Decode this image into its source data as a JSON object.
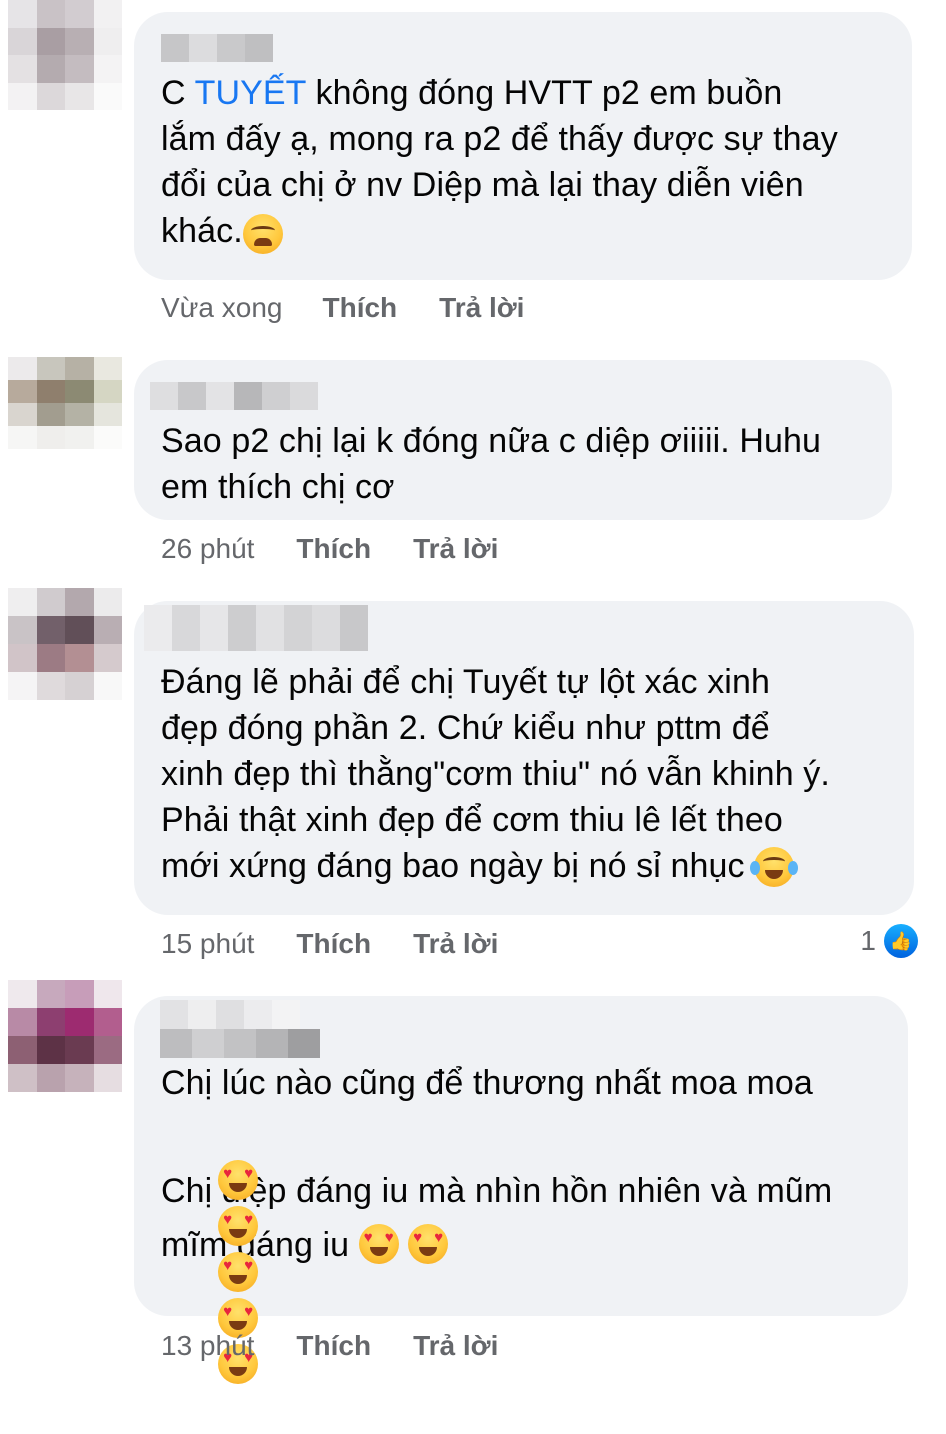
{
  "comments": [
    {
      "text_parts": [
        "C ",
        "TUYẾT",
        " không đóng HVTT p2 em buồn\nlắm đấy ạ, mong ra p2 để thấy được sự thay\nđổi của chị ở nv Diệp mà lại thay diễn viên\nkhác."
      ],
      "emojis": [
        "weary-face-emoji"
      ],
      "time": "Vừa xong",
      "like_label": "Thích",
      "reply_label": "Trả lời"
    },
    {
      "text": "Sao p2 chị lại k đóng nữa c diệp ơiiiii. Huhu\nem thích chị cơ",
      "time": "26 phút",
      "like_label": "Thích",
      "reply_label": "Trả lời"
    },
    {
      "text": "Đáng lẽ phải để chị Tuyết tự lột xác xinh\nđẹp đóng phần 2. Chứ kiểu như pttm để\nxinh đẹp thì thằng\"cơm thiu\" nó vẫn khinh ý.\nPhải thật xinh đẹp để cơm thiu lê lết theo\nmới xứng đáng bao ngày bị nó sỉ nhục ",
      "emojis": [
        "laughing-tears-emoji"
      ],
      "time": "15 phút",
      "like_label": "Thích",
      "reply_label": "Trả lời",
      "reaction_count": "1"
    },
    {
      "line1": "Chị lúc nào cũng để thương nhất moa moa",
      "line3": "Chị diệp đáng iu mà nhìn hồn nhiên và mũm",
      "line4": "mĩm đáng iu ",
      "emojis_line2": [
        "heart-eyes-emoji",
        "heart-eyes-emoji",
        "heart-eyes-emoji",
        "heart-eyes-emoji",
        "heart-eyes-emoji"
      ],
      "emojis_line4": [
        "heart-eyes-emoji",
        "heart-eyes-emoji"
      ],
      "time": "13 phút",
      "like_label": "Thích",
      "reply_label": "Trả lời"
    }
  ],
  "colors": {
    "bubble_bg": "#f0f2f5",
    "tag_blue": "#1877f2",
    "meta_gray": "#65676b"
  }
}
